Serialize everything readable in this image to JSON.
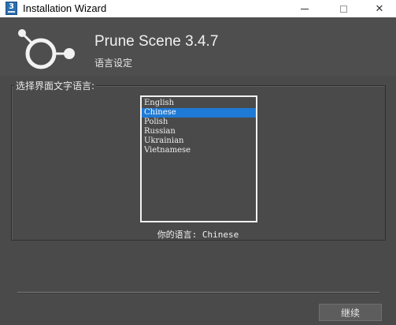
{
  "window": {
    "title": "Installation Wizard",
    "icon_label": "3",
    "controls": {
      "minimize": "minimize-icon",
      "maximize": "maximize-icon",
      "close": "✕"
    }
  },
  "header": {
    "product_name": "Prune Scene 3.4.7",
    "subtitle": "语言设定",
    "logo": "prune-logo-icon"
  },
  "language_group": {
    "label": "选择界面文字语言:",
    "options": [
      "English",
      "Chinese",
      "Polish",
      "Russian",
      "Ukrainian",
      "Vietnamese"
    ],
    "selected": "Chinese",
    "current_label": "你的语言: Chinese"
  },
  "footer": {
    "continue_label": "继续"
  },
  "colors": {
    "background": "#4a4a4a",
    "selection": "#1f7ad6",
    "title_bar": "#ffffff"
  }
}
